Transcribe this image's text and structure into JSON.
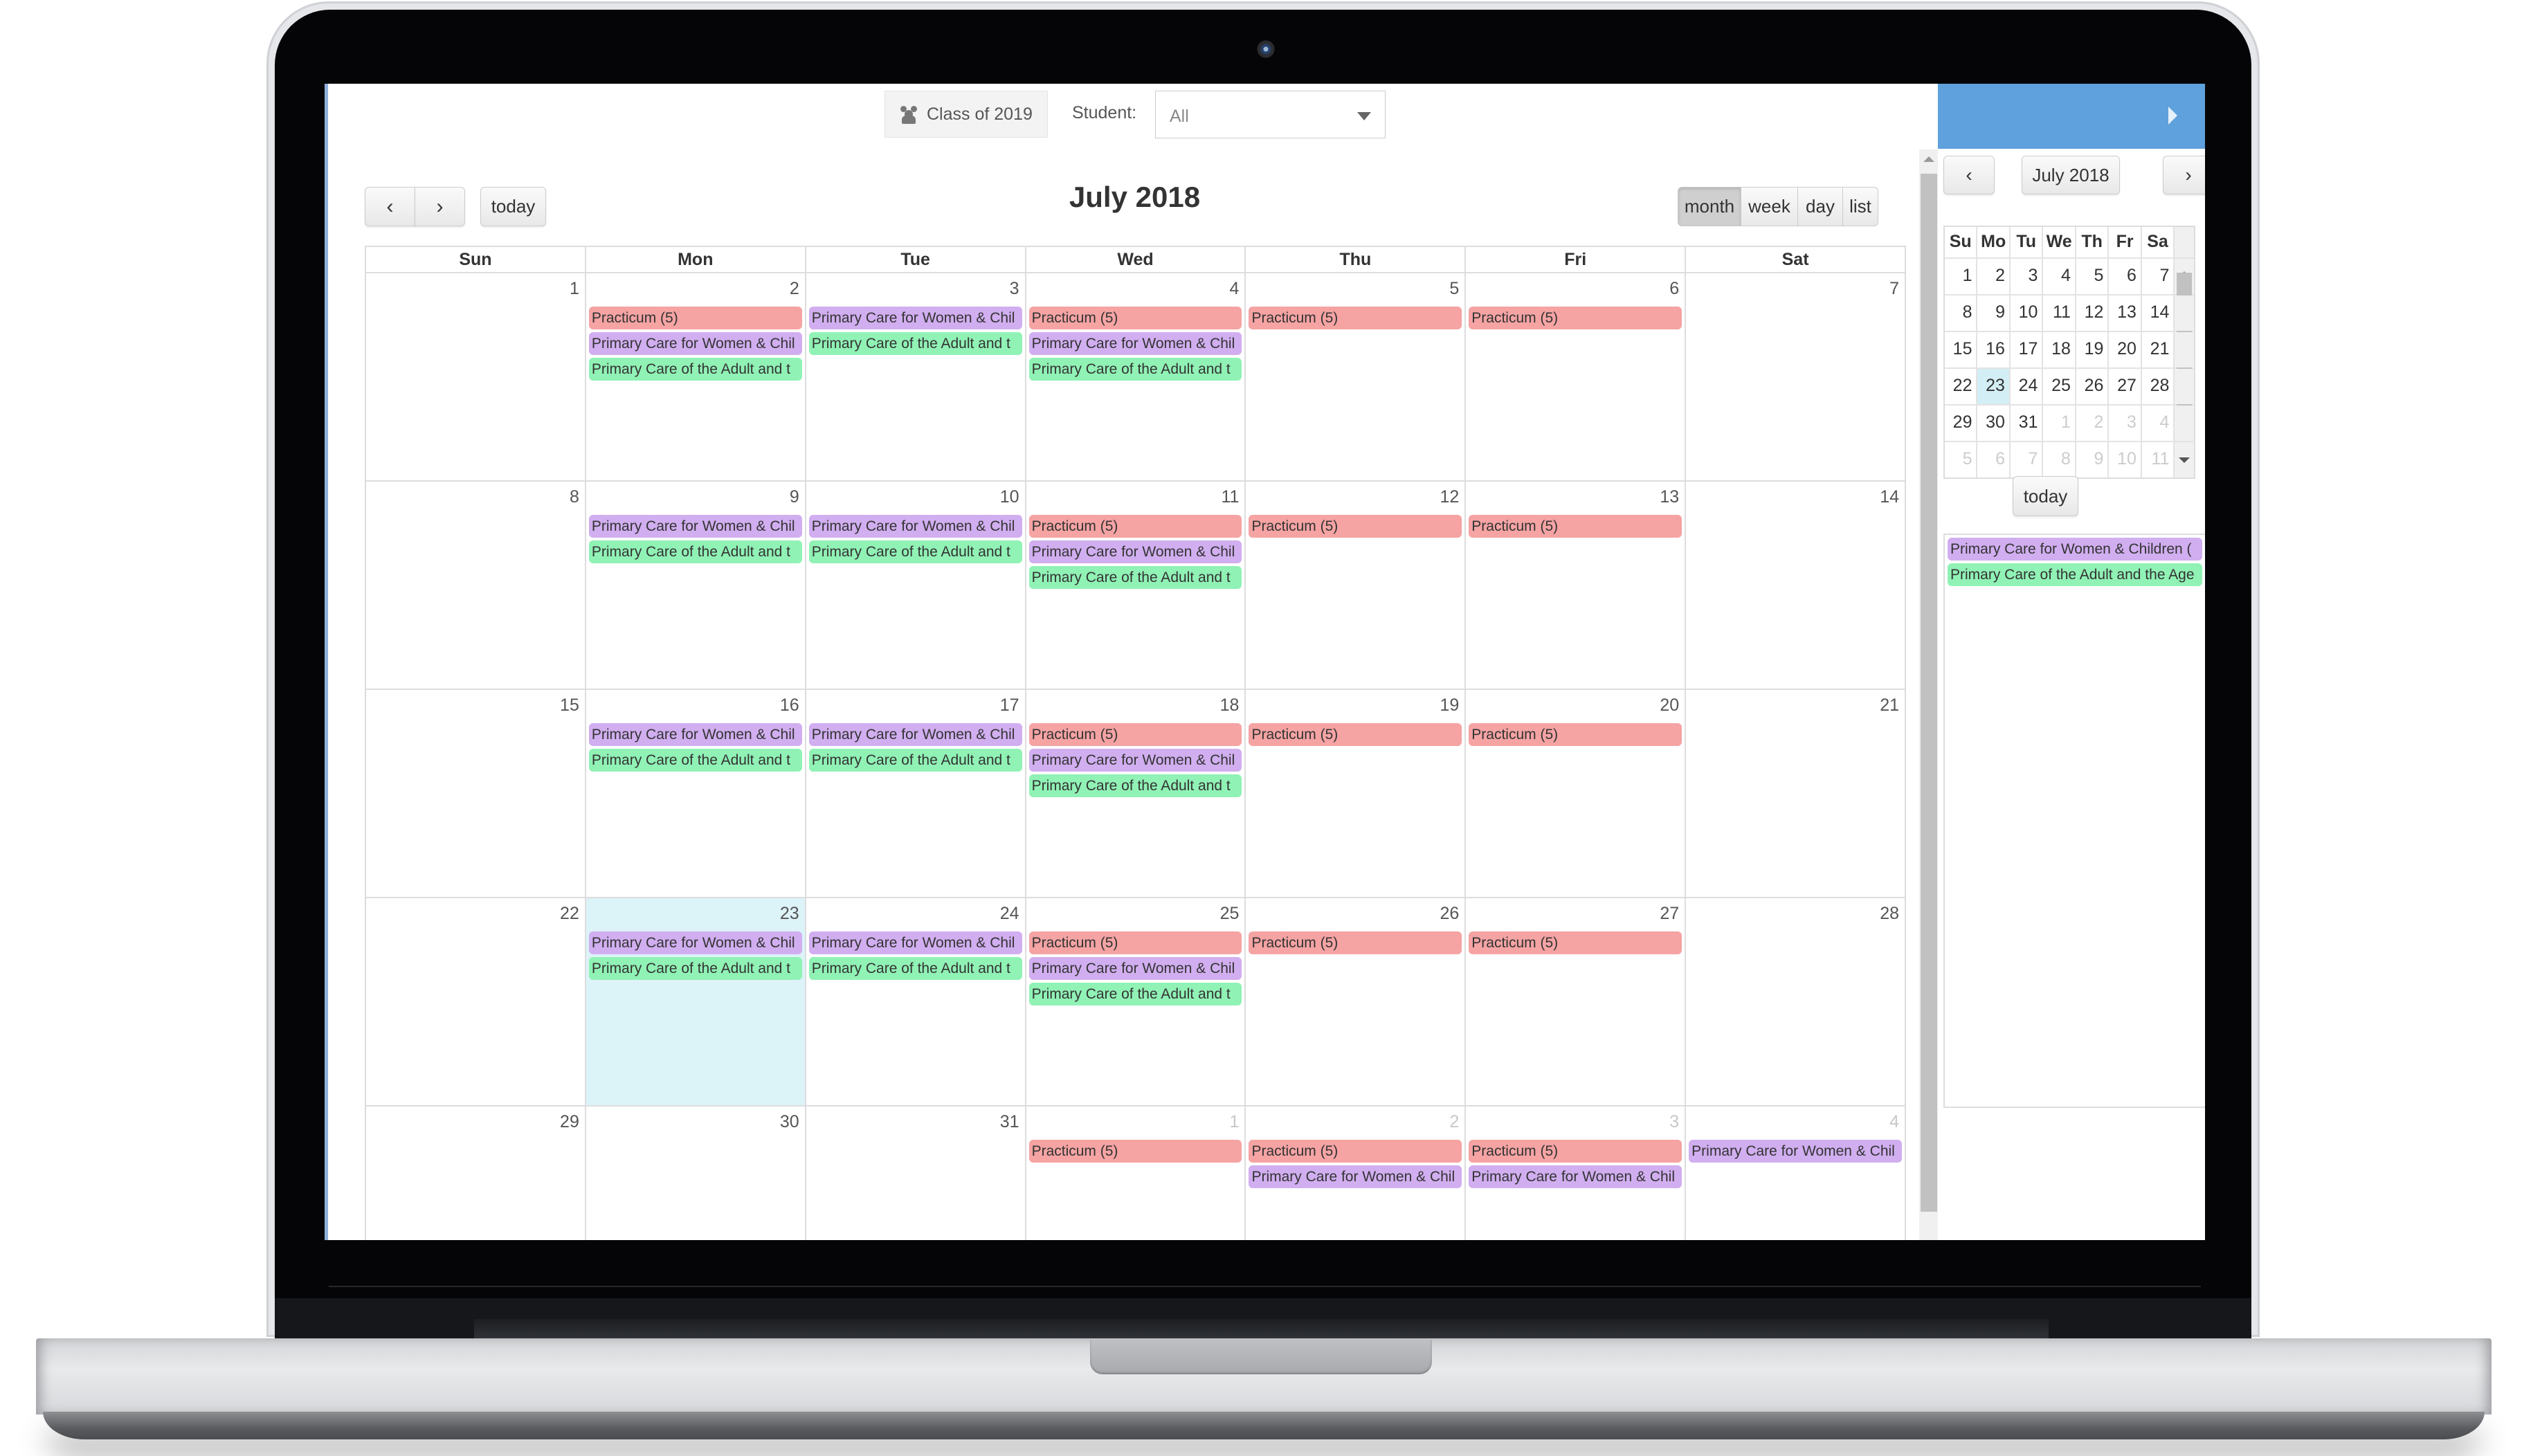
{
  "toolbar": {
    "class_label": "Class of 2019",
    "class_icon": "users-icon",
    "student_label": "Student:",
    "student_value": "All"
  },
  "calendar": {
    "title": "July 2018",
    "prev_icon": "chevron-left-icon",
    "next_icon": "chevron-right-icon",
    "prev_glyph": "‹",
    "next_glyph": "›",
    "today_label": "today",
    "views": [
      {
        "label": "month",
        "active": true
      },
      {
        "label": "week",
        "active": false
      },
      {
        "label": "day",
        "active": false
      },
      {
        "label": "list",
        "active": false
      }
    ],
    "weekdays": [
      "Sun",
      "Mon",
      "Tue",
      "Wed",
      "Thu",
      "Fri",
      "Sat"
    ],
    "event_types": {
      "practicum": {
        "label": "Practicum (5)",
        "color": "#f5a3a3"
      },
      "women": {
        "label": "Primary Care for Women & Chil",
        "color": "#d1aef0"
      },
      "adult": {
        "label": "Primary Care of the Adult and t",
        "color": "#90f2b5"
      }
    },
    "weeks": [
      [
        {
          "n": "1",
          "events": []
        },
        {
          "n": "2",
          "events": [
            "practicum",
            "women",
            "adult"
          ]
        },
        {
          "n": "3",
          "events": [
            "women",
            "adult"
          ]
        },
        {
          "n": "4",
          "events": [
            "practicum",
            "women",
            "adult"
          ]
        },
        {
          "n": "5",
          "events": [
            "practicum"
          ]
        },
        {
          "n": "6",
          "events": [
            "practicum"
          ]
        },
        {
          "n": "7",
          "events": []
        }
      ],
      [
        {
          "n": "8",
          "events": []
        },
        {
          "n": "9",
          "events": [
            "women",
            "adult"
          ]
        },
        {
          "n": "10",
          "events": [
            "women",
            "adult"
          ]
        },
        {
          "n": "11",
          "events": [
            "practicum",
            "women",
            "adult"
          ]
        },
        {
          "n": "12",
          "events": [
            "practicum"
          ]
        },
        {
          "n": "13",
          "events": [
            "practicum"
          ]
        },
        {
          "n": "14",
          "events": []
        }
      ],
      [
        {
          "n": "15",
          "events": []
        },
        {
          "n": "16",
          "events": [
            "women",
            "adult"
          ]
        },
        {
          "n": "17",
          "events": [
            "women",
            "adult"
          ]
        },
        {
          "n": "18",
          "events": [
            "practicum",
            "women",
            "adult"
          ]
        },
        {
          "n": "19",
          "events": [
            "practicum"
          ]
        },
        {
          "n": "20",
          "events": [
            "practicum"
          ]
        },
        {
          "n": "21",
          "events": []
        }
      ],
      [
        {
          "n": "22",
          "events": []
        },
        {
          "n": "23",
          "events": [
            "women",
            "adult"
          ],
          "today": true
        },
        {
          "n": "24",
          "events": [
            "women",
            "adult"
          ]
        },
        {
          "n": "25",
          "events": [
            "practicum",
            "women",
            "adult"
          ]
        },
        {
          "n": "26",
          "events": [
            "practicum"
          ]
        },
        {
          "n": "27",
          "events": [
            "practicum"
          ]
        },
        {
          "n": "28",
          "events": []
        }
      ],
      [
        {
          "n": "29",
          "events": []
        },
        {
          "n": "30",
          "events": []
        },
        {
          "n": "31",
          "events": []
        },
        {
          "n": "1",
          "events": [
            "practicum"
          ],
          "other": true
        },
        {
          "n": "2",
          "events": [
            "practicum",
            "women"
          ],
          "other": true
        },
        {
          "n": "3",
          "events": [
            "practicum",
            "women"
          ],
          "other": true
        },
        {
          "n": "4",
          "events": [
            "women"
          ],
          "other": true
        }
      ]
    ],
    "today_color": "#dcf3f8"
  },
  "side_panel": {
    "header_color": "#5ea1dc",
    "collapse_icon": "caret-right-icon",
    "mini_title": "July 2018",
    "mini_prev_glyph": "‹",
    "mini_next_glyph": "›",
    "weekdays": [
      "Su",
      "Mo",
      "Tu",
      "We",
      "Th",
      "Fr",
      "Sa"
    ],
    "weeks": [
      [
        [
          "1",
          0
        ],
        [
          "2",
          0
        ],
        [
          "3",
          0
        ],
        [
          "4",
          0
        ],
        [
          "5",
          0
        ],
        [
          "6",
          0
        ],
        [
          "7",
          0
        ]
      ],
      [
        [
          "8",
          0
        ],
        [
          "9",
          0
        ],
        [
          "10",
          0
        ],
        [
          "11",
          0
        ],
        [
          "12",
          0
        ],
        [
          "13",
          0
        ],
        [
          "14",
          0
        ]
      ],
      [
        [
          "15",
          0
        ],
        [
          "16",
          0
        ],
        [
          "17",
          0
        ],
        [
          "18",
          0
        ],
        [
          "19",
          0
        ],
        [
          "20",
          0
        ],
        [
          "21",
          0
        ]
      ],
      [
        [
          "22",
          0
        ],
        [
          "23",
          "today"
        ],
        [
          "24",
          0
        ],
        [
          "25",
          0
        ],
        [
          "26",
          0
        ],
        [
          "27",
          0
        ],
        [
          "28",
          0
        ]
      ],
      [
        [
          "29",
          0
        ],
        [
          "30",
          0
        ],
        [
          "31",
          0
        ],
        [
          "1",
          "other"
        ],
        [
          "2",
          "other"
        ],
        [
          "3",
          "other"
        ],
        [
          "4",
          "other"
        ]
      ],
      [
        [
          "5",
          "other"
        ],
        [
          "6",
          "other"
        ],
        [
          "7",
          "other"
        ],
        [
          "8",
          "other"
        ],
        [
          "9",
          "other"
        ],
        [
          "10",
          "other"
        ],
        [
          "11",
          "other"
        ]
      ]
    ],
    "today_label": "today",
    "agenda": [
      {
        "label": "Primary Care for Women & Children (",
        "color": "#d1aef0"
      },
      {
        "label": "Primary Care of the Adult and the Age",
        "color": "#90f2b5"
      }
    ]
  }
}
